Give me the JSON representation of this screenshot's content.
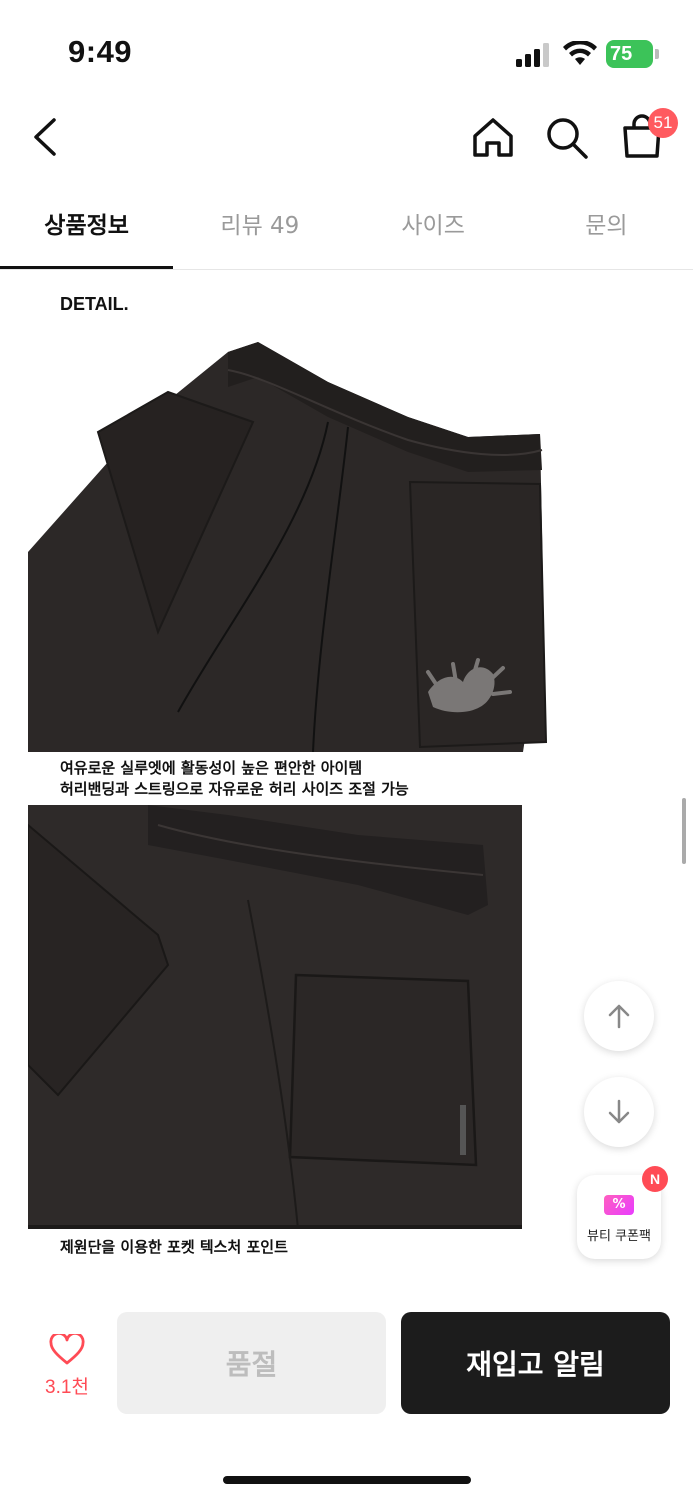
{
  "status": {
    "time": "9:49",
    "battery": "75"
  },
  "nav": {
    "back_icon": "chevron-left-icon",
    "home_icon": "home-icon",
    "search_icon": "search-icon",
    "cart_icon": "shopping-bag-icon",
    "cart_count": "51"
  },
  "tabs": [
    {
      "label": "상품정보",
      "active": true
    },
    {
      "label": "리뷰 49",
      "active": false
    },
    {
      "label": "사이즈",
      "active": false
    },
    {
      "label": "문의",
      "active": false
    }
  ],
  "content": {
    "detail_title": "DETAIL.",
    "caption1_line1": "여유로운 실루엣에 활동성이 높은 편안한 아이템",
    "caption1_line2": "허리밴딩과 스트링으로 자유로운 허리 사이즈 조절 가능",
    "caption2": "제원단을 이용한 포켓 텍스처 포인트"
  },
  "floating": {
    "scroll_up_icon": "arrow-up-icon",
    "scroll_down_icon": "arrow-down-icon",
    "coupon_label": "뷰티 쿠폰팩",
    "coupon_icon_text": "%",
    "coupon_badge": "N"
  },
  "bottom_bar": {
    "like_count": "3.1천",
    "soldout_label": "품절",
    "restock_label": "재입고 알림"
  },
  "colors": {
    "accent_red": "#ff4b55",
    "battery_green": "#3cc359",
    "dark_button": "#1c1c1c"
  }
}
